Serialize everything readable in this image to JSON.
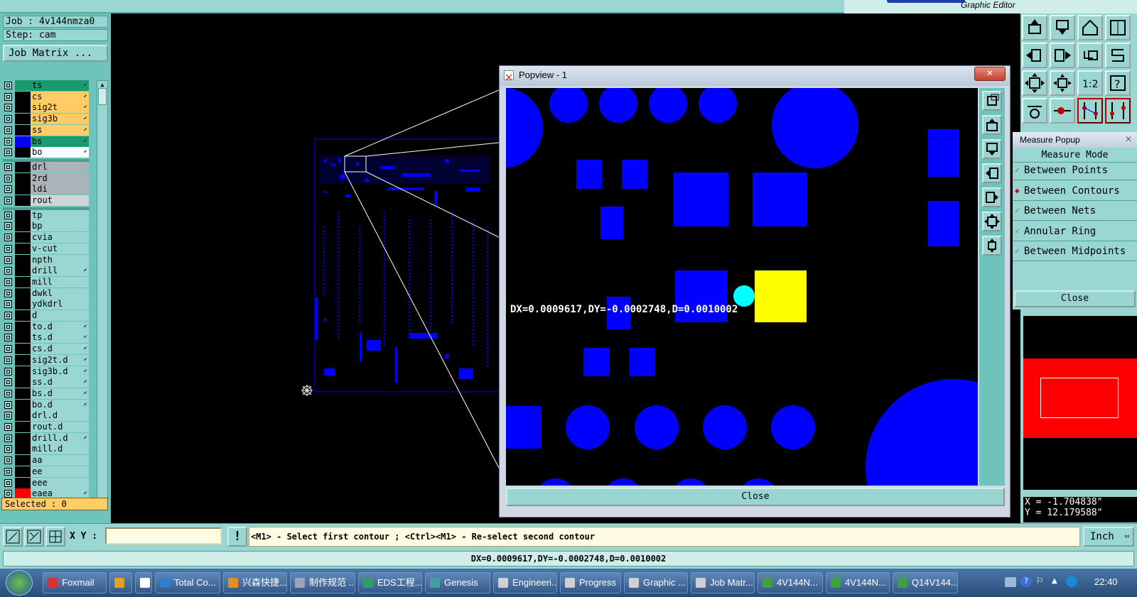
{
  "app": {
    "subtitle": "Graphic Editor"
  },
  "job": {
    "label": "Job : 4v144nmza0",
    "step": "Step: cam",
    "matrix_button": "Job Matrix ..."
  },
  "layers": [
    {
      "name": "ts",
      "color": "#1a9a6e",
      "bg": "#1a9a6e",
      "arrow": true
    },
    {
      "name": "cs",
      "color": "#000000",
      "bg": "#ffcc66",
      "arrow": true
    },
    {
      "name": "sig2t",
      "color": "#000000",
      "bg": "#ffcc66",
      "arrow": true
    },
    {
      "name": "sig3b",
      "color": "#000000",
      "bg": "#ffcc66",
      "arrow": true
    },
    {
      "name": "ss",
      "color": "#000000",
      "bg": "#ffcc66",
      "arrow": true
    },
    {
      "name": "bs",
      "color": "#0000ff",
      "bg": "#1a9a6e",
      "arrow": true
    },
    {
      "name": "bo",
      "color": "#000000",
      "bg": "#ffffff",
      "arrow": true
    },
    {
      "name": "drl",
      "color": "#000000",
      "bg": "#a9b3b8",
      "arrow": false
    },
    {
      "name": "2rd",
      "color": "#000000",
      "bg": "#a9b3b8",
      "arrow": false
    },
    {
      "name": "ldi",
      "color": "#000000",
      "bg": "#a9b3b8",
      "arrow": false
    },
    {
      "name": "rout",
      "color": "#000000",
      "bg": "#cfd6d8",
      "arrow": false
    },
    {
      "name": "tp",
      "color": "#000000",
      "bg": "#99d6d1",
      "arrow": false
    },
    {
      "name": "bp",
      "color": "#000000",
      "bg": "#99d6d1",
      "arrow": false
    },
    {
      "name": "cvia",
      "color": "#000000",
      "bg": "#99d6d1",
      "arrow": false
    },
    {
      "name": "v-cut",
      "color": "#000000",
      "bg": "#99d6d1",
      "arrow": false
    },
    {
      "name": "npth",
      "color": "#000000",
      "bg": "#99d6d1",
      "arrow": false
    },
    {
      "name": "drill",
      "color": "#000000",
      "bg": "#99d6d1",
      "arrow": true
    },
    {
      "name": "mill",
      "color": "#000000",
      "bg": "#99d6d1",
      "arrow": false
    },
    {
      "name": "dwkl",
      "color": "#000000",
      "bg": "#99d6d1",
      "arrow": false
    },
    {
      "name": "ydkdrl",
      "color": "#000000",
      "bg": "#99d6d1",
      "arrow": false
    },
    {
      "name": "d",
      "color": "#000000",
      "bg": "#99d6d1",
      "arrow": false
    },
    {
      "name": "to.d",
      "color": "#000000",
      "bg": "#99d6d1",
      "arrow": true
    },
    {
      "name": "ts.d",
      "color": "#000000",
      "bg": "#99d6d1",
      "arrow": true
    },
    {
      "name": "cs.d",
      "color": "#000000",
      "bg": "#99d6d1",
      "arrow": true
    },
    {
      "name": "sig2t.d",
      "color": "#000000",
      "bg": "#99d6d1",
      "arrow": true
    },
    {
      "name": "sig3b.d",
      "color": "#000000",
      "bg": "#99d6d1",
      "arrow": true
    },
    {
      "name": "ss.d",
      "color": "#000000",
      "bg": "#99d6d1",
      "arrow": true
    },
    {
      "name": "bs.d",
      "color": "#000000",
      "bg": "#99d6d1",
      "arrow": true
    },
    {
      "name": "bo.d",
      "color": "#000000",
      "bg": "#99d6d1",
      "arrow": true
    },
    {
      "name": "drl.d",
      "color": "#000000",
      "bg": "#99d6d1",
      "arrow": false
    },
    {
      "name": "rout.d",
      "color": "#000000",
      "bg": "#99d6d1",
      "arrow": false
    },
    {
      "name": "drill.d",
      "color": "#000000",
      "bg": "#99d6d1",
      "arrow": true
    },
    {
      "name": "mill.d",
      "color": "#000000",
      "bg": "#99d6d1",
      "arrow": false
    },
    {
      "name": "aa",
      "color": "#000000",
      "bg": "#99d6d1",
      "arrow": false
    },
    {
      "name": "ee",
      "color": "#000000",
      "bg": "#99d6d1",
      "arrow": false
    },
    {
      "name": "eee",
      "color": "#000000",
      "bg": "#99d6d1",
      "arrow": false
    },
    {
      "name": "eaea",
      "color": "#ff0000",
      "bg": "#99d6d1",
      "arrow": true
    }
  ],
  "selected": "Selected : 0",
  "popview": {
    "title": "Popview - 1",
    "measurement": "DX=0.0009617,DY=-0.0002748,D=0.0010002",
    "close_label": "Close"
  },
  "measure_popup": {
    "title": "Measure Popup",
    "mode_label": "Measure Mode",
    "options": [
      {
        "label": "Between Points",
        "active": false
      },
      {
        "label": "Between Contours",
        "active": true
      },
      {
        "label": "Between Nets",
        "active": false
      },
      {
        "label": "Annular Ring",
        "active": false
      },
      {
        "label": "Between Midpoints",
        "active": false
      }
    ],
    "close_label": "Close"
  },
  "cursor": {
    "x": "X = -1.704838\"",
    "y": "Y = 12.179588\""
  },
  "command": {
    "xy_label": "X Y :",
    "xy_value": "",
    "prompt": "<M1> - Select first contour ; <Ctrl><M1> - Re-select second contour",
    "unit": "Inch"
  },
  "status": "DX=0.0009617,DY=-0.0002748,D=0.0010002",
  "taskbar": {
    "items": [
      "Foxmail",
      "",
      "",
      "Total Co...",
      "兴森快捷...",
      "制作规范 ...",
      "EDS工程...",
      "Genesis",
      "Engineeri...",
      "Progress",
      "Graphic ...",
      "Job Matr...",
      "4V144N...",
      "4V144N...",
      "Q14V144..."
    ],
    "clock": "22:40"
  },
  "colors": {
    "pad_blue": "#0000ff",
    "highlight": "#ffff00",
    "cursor": "#00ffff",
    "teal": "#99d6d1"
  }
}
